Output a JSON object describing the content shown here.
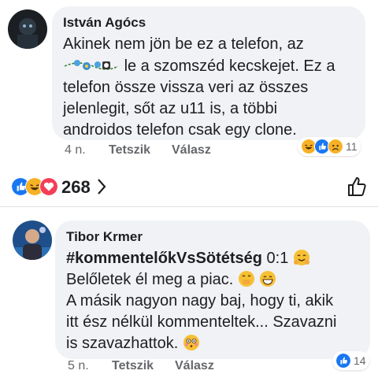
{
  "comments": [
    {
      "author": "István Agócs",
      "text_lines": [
        "Akinek nem jön be ez a telefon, az",
        "le a szomszéd kecskejet. Ez a",
        "telefon össze vissza veri az összes",
        "jelenlegit, sőt az u11 is, a többi",
        "androidos telefon csak egy clone."
      ],
      "time": "4 n.",
      "like_label": "Tetszik",
      "reply_label": "Válasz",
      "reaction_count": "11",
      "reaction_icons": [
        "haha-icon",
        "like-icon",
        "sad-icon"
      ]
    },
    {
      "author": "Tibor Krmer",
      "hashtag": "#kommentelőkVsSötétség",
      "hashtag_suffix": " 0:1",
      "text_lines": [
        "Belőletek él meg a piac.",
        "A másik nagyon nagy baj, hogy ti, akik",
        "itt ész nélkül kommenteltek... Szavazni",
        "is szavazhattok."
      ],
      "time": "5 n.",
      "like_label": "Tetszik",
      "reply_label": "Válasz",
      "reaction_count": "14",
      "reaction_icons": [
        "like-icon"
      ]
    }
  ],
  "post_bar": {
    "reaction_count": "268",
    "reaction_icons": [
      "like-icon",
      "haha-icon",
      "love-icon"
    ]
  },
  "colors": {
    "bubble": "#f0f2f5",
    "like_blue": "#1877f2",
    "love_red": "#f33e58",
    "haha_yellow": "#f7b125",
    "meta_gray": "#65676b"
  }
}
